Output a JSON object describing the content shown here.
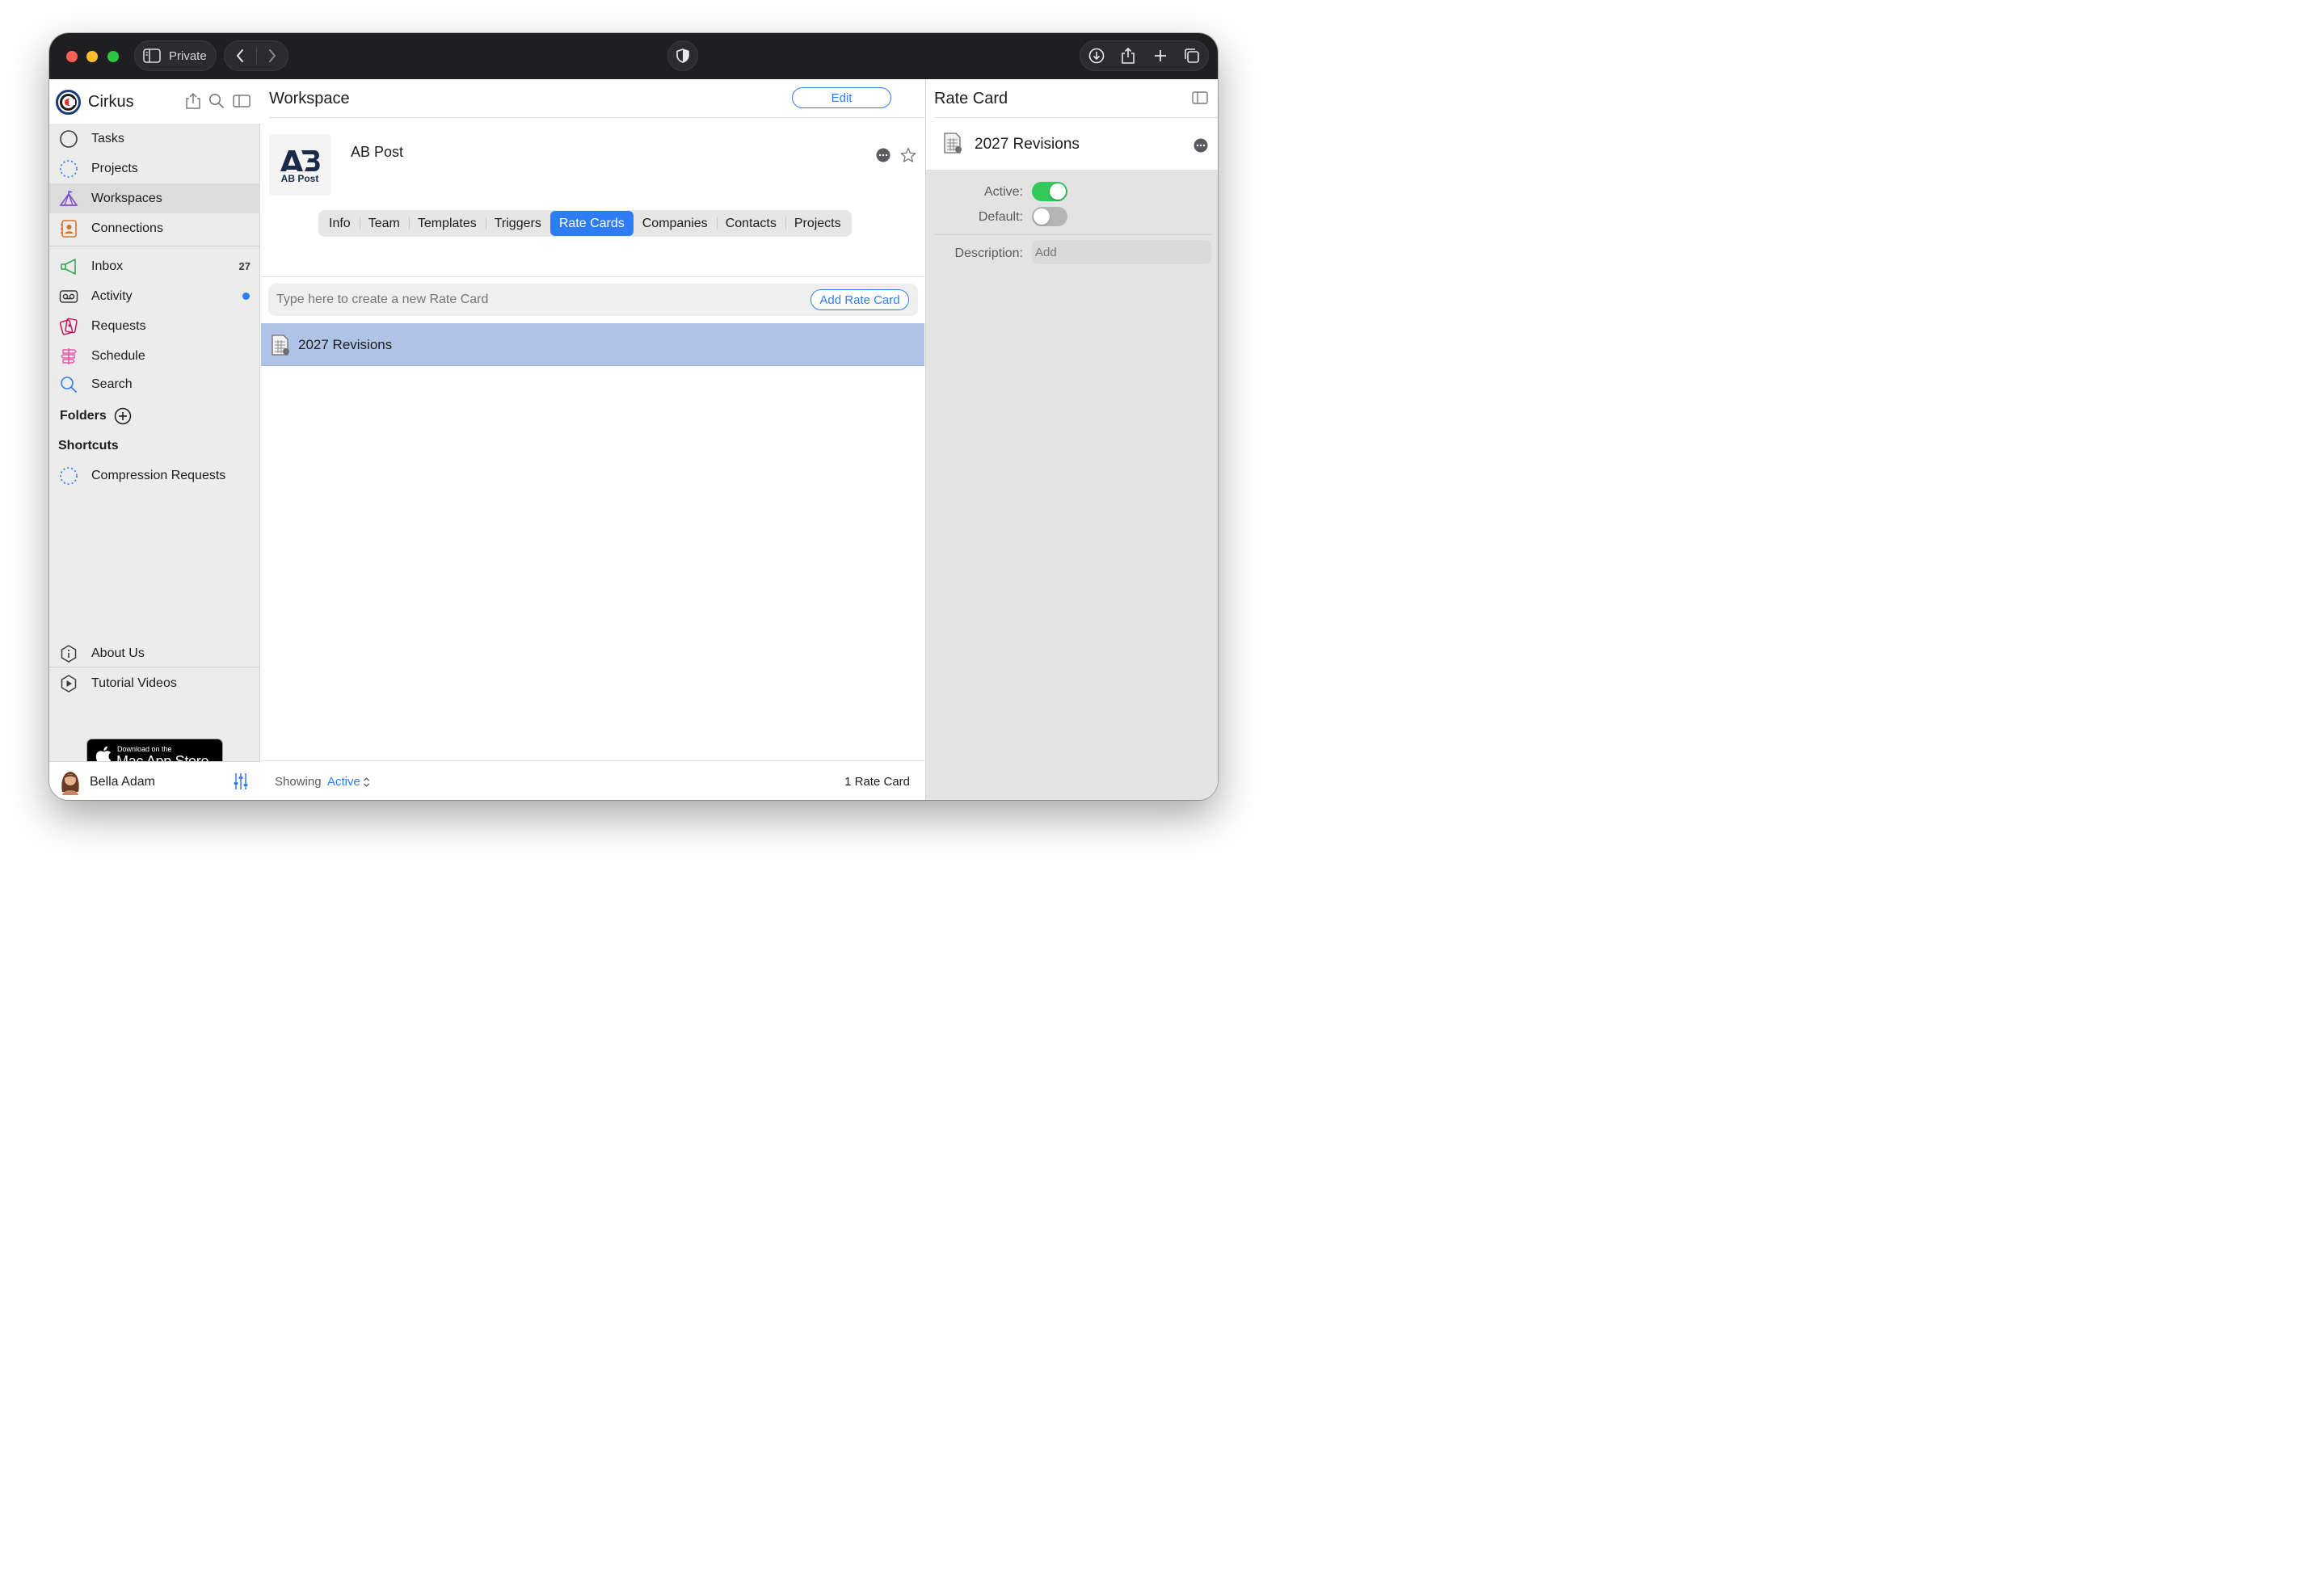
{
  "browser": {
    "private_label": "Private"
  },
  "sidebar": {
    "app_name": "Cirkus",
    "nav": [
      {
        "label": "Tasks",
        "icon": "circle-icon"
      },
      {
        "label": "Projects",
        "icon": "dotted-circle-icon"
      },
      {
        "label": "Workspaces",
        "icon": "circus-tent-icon"
      },
      {
        "label": "Connections",
        "icon": "contact-card-icon"
      }
    ],
    "inbox": {
      "label": "Inbox",
      "badge": "27"
    },
    "activity": {
      "label": "Activity"
    },
    "requests": {
      "label": "Requests"
    },
    "schedule": {
      "label": "Schedule"
    },
    "search": {
      "label": "Search"
    },
    "folders_label": "Folders",
    "shortcuts_label": "Shortcuts",
    "shortcut_item": "Compression Requests",
    "about_label": "About Us",
    "tutorial_label": "Tutorial Videos",
    "appstore": {
      "small": "Download on the",
      "big": "Mac App Store"
    },
    "user_name": "Bella Adam"
  },
  "main": {
    "title": "Workspace",
    "edit_label": "Edit",
    "workspace_name": "AB Post",
    "logo_text": "AB Post",
    "logo_mark": "AB",
    "tabs": [
      "Info",
      "Team",
      "Templates",
      "Triggers",
      "Rate Cards",
      "Companies",
      "Contacts",
      "Projects"
    ],
    "active_tab": "Rate Cards",
    "new_placeholder": "Type here to create a new Rate Card",
    "add_button": "Add Rate Card",
    "rows": [
      {
        "name": "2027 Revisions"
      }
    ],
    "footer": {
      "showing_label": "Showing",
      "filter_value": "Active",
      "count": "1 Rate Card"
    }
  },
  "detail": {
    "title": "Rate Card",
    "item_name": "2027 Revisions",
    "active_label": "Active:",
    "active_on": true,
    "default_label": "Default:",
    "default_on": false,
    "description_label": "Description:",
    "description_placeholder": "Add"
  },
  "colors": {
    "accent": "#2f7df6",
    "selection": "#aec3e6",
    "toggle_on": "#34c759",
    "toggle_off": "#b5b5b5"
  }
}
